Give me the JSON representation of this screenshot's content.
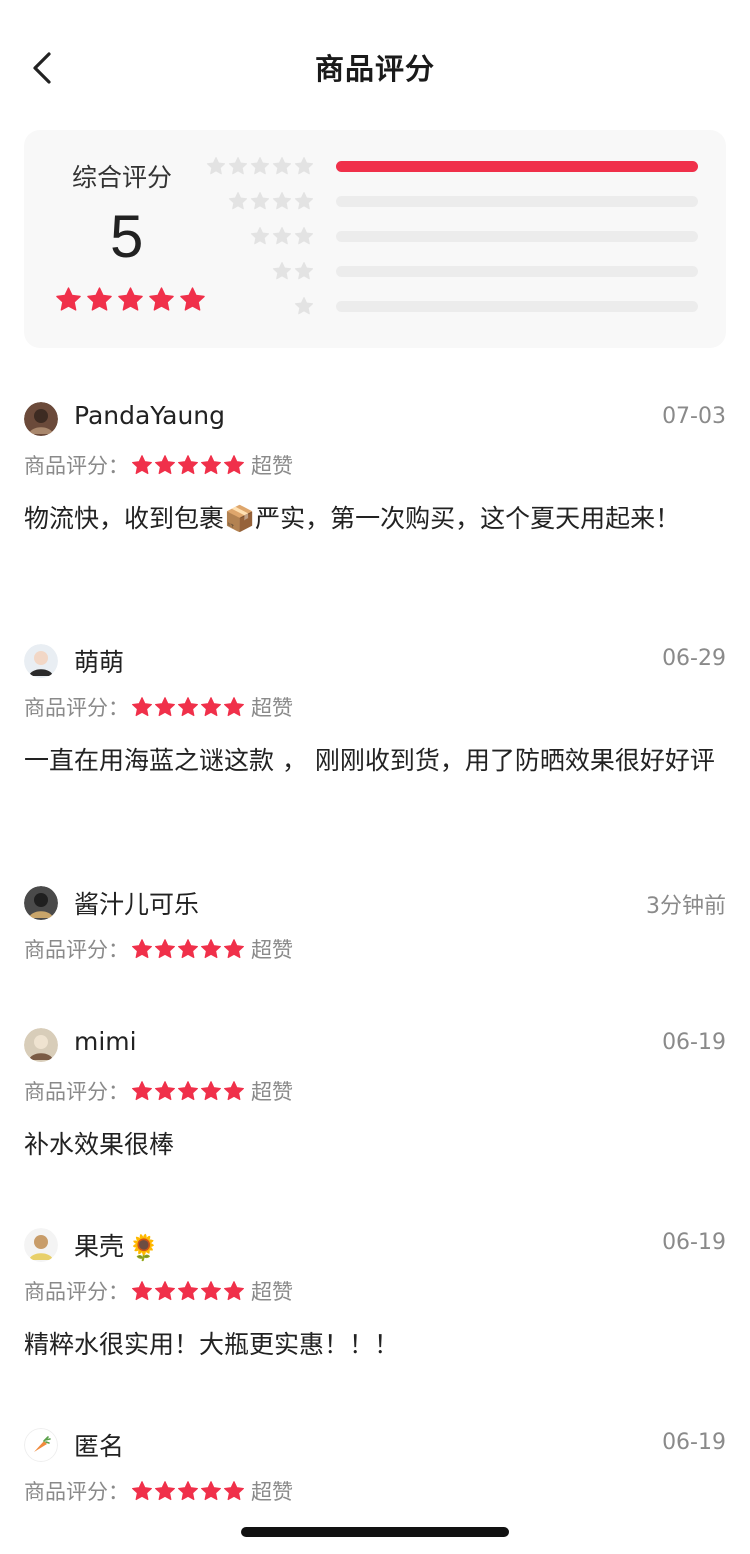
{
  "header": {
    "title": "商品评分"
  },
  "summary": {
    "label": "综合评分",
    "score": "5",
    "distribution": [
      {
        "stars": 5,
        "fraction": 1.0
      },
      {
        "stars": 4,
        "fraction": 0.0
      },
      {
        "stars": 3,
        "fraction": 0.0
      },
      {
        "stars": 2,
        "fraction": 0.0
      },
      {
        "stars": 1,
        "fraction": 0.0
      }
    ]
  },
  "colors": {
    "accent": "#f0304a",
    "star_inactive": "#e3e3e3",
    "muted_text": "#8a8a8a"
  },
  "rating_prefix": "商品评分：",
  "reviews": [
    {
      "username": "PandaYaung",
      "date": "07-03",
      "rating": 5,
      "rating_word": "超赞",
      "text": "物流快，收到包裹📦严实，第一次购买，这个夏天用起来！",
      "avatar_icon": "avatar-photo-icon"
    },
    {
      "username": "萌萌",
      "date": "06-29",
      "rating": 5,
      "rating_word": "超赞",
      "text": "一直在用海蓝之谜这款 ， 刚刚收到货，用了防晒效果很好好评",
      "avatar_icon": "avatar-photo-icon"
    },
    {
      "username": "酱汁儿可乐",
      "date": "3分钟前",
      "rating": 5,
      "rating_word": "超赞",
      "text": "",
      "avatar_icon": "avatar-photo-icon"
    },
    {
      "username": "mimi",
      "date": "06-19",
      "rating": 5,
      "rating_word": "超赞",
      "text": "补水效果很棒",
      "avatar_icon": "avatar-photo-icon"
    },
    {
      "username": "果壳",
      "username_emoji": "🌻",
      "date": "06-19",
      "rating": 5,
      "rating_word": "超赞",
      "text": "精粹水很实用！大瓶更实惠！！！",
      "avatar_icon": "avatar-photo-icon"
    },
    {
      "username": "匿名",
      "date": "06-19",
      "rating": 5,
      "rating_word": "超赞",
      "text": "",
      "avatar_icon": "carrot-icon"
    }
  ]
}
